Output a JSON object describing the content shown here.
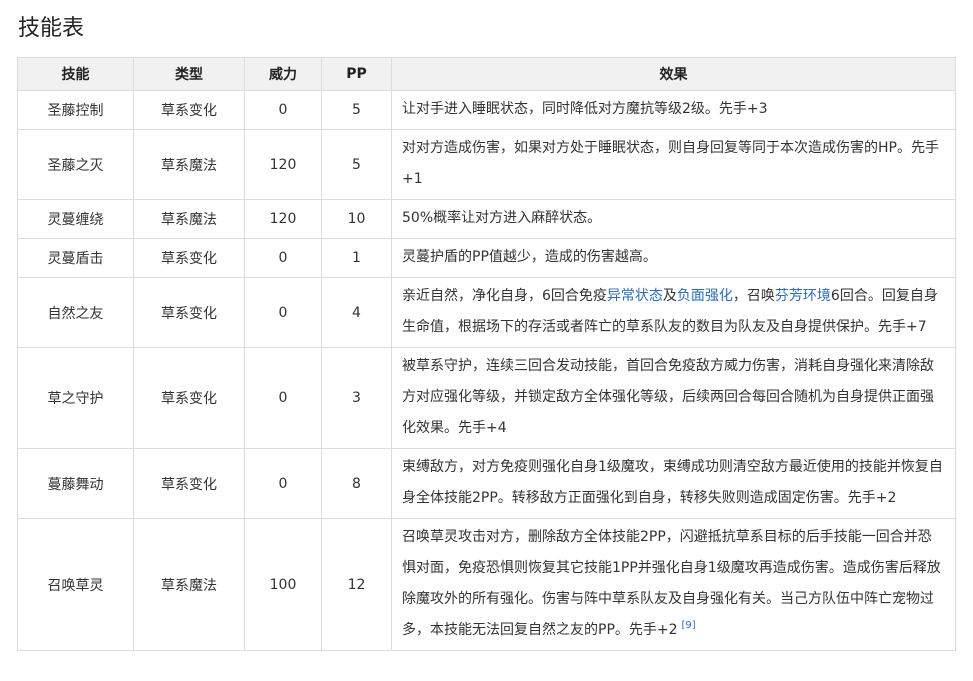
{
  "title": "技能表",
  "headers": {
    "skill": "技能",
    "type": "类型",
    "power": "威力",
    "pp": "PP",
    "effect": "效果"
  },
  "rows": [
    {
      "name": "圣藤控制",
      "type": "草系变化",
      "power": "0",
      "pp": "5",
      "effect": [
        "让对手进入睡眠状态，同时降低对方魔抗等级2级。先手+3"
      ]
    },
    {
      "name": "圣藤之灭",
      "type": "草系魔法",
      "power": "120",
      "pp": "5",
      "effect": [
        "对对方造成伤害，如果对方处于睡眠状态，则自身回复等同于本次造成伤害的HP。先手+1"
      ]
    },
    {
      "name": "灵蔓缠绕",
      "type": "草系魔法",
      "power": "120",
      "pp": "10",
      "effect": [
        "50%概率让对方进入麻醉状态。"
      ]
    },
    {
      "name": "灵蔓盾击",
      "type": "草系变化",
      "power": "0",
      "pp": "1",
      "effect": [
        "灵蔓护盾的PP值越少，造成的伤害越高。"
      ]
    },
    {
      "name": "自然之友",
      "type": "草系变化",
      "power": "0",
      "pp": "4",
      "effect": [
        "亲近自然，净化自身，6回合免疫",
        "异常状态",
        "及",
        "负面强化",
        "，召唤",
        "芬芳环境",
        "6回合。回复自身生命值，根据场下的存活或者阵亡的草系队友的数目为队友及自身提供保护。先手+7"
      ]
    },
    {
      "name": "草之守护",
      "type": "草系变化",
      "power": "0",
      "pp": "3",
      "effect": [
        "被草系守护，连续三回合发动技能，首回合免疫敌方威力伤害，消耗自身强化来清除敌方对应强化等级，并锁定敌方全体强化等级，后续两回合每回合随机为自身提供正面强化效果。先手+4"
      ]
    },
    {
      "name": "蔓藤舞动",
      "type": "草系变化",
      "power": "0",
      "pp": "8",
      "effect": [
        "束缚敌方，对方免疫则强化自身1级魔攻，束缚成功则清空敌方最近使用的技能并恢复自身全体技能2PP。转移敌方正面强化到自身，转移失败则造成固定伤害。先手+2"
      ]
    },
    {
      "name": "召唤草灵",
      "type": "草系魔法",
      "power": "100",
      "pp": "12",
      "effect": [
        "召唤草灵攻击对方，删除敌方全体技能2PP，闪避抵抗草系目标的后手技能一回合并恐惧对面，免疫恐惧则恢复其它技能1PP并强化自身1级魔攻再造成伤害。造成伤害后释放除魔攻外的所有强化。伤害与阵中草系队友及自身强化有关。当己方队伍中阵亡宠物过多，本技能无法回复自然之友的PP。先手+2",
        "[9]"
      ]
    }
  ],
  "colors": {
    "link": "#2a6cc0",
    "header_bg": "#f1f1f1",
    "border": "#dcdcdc"
  }
}
